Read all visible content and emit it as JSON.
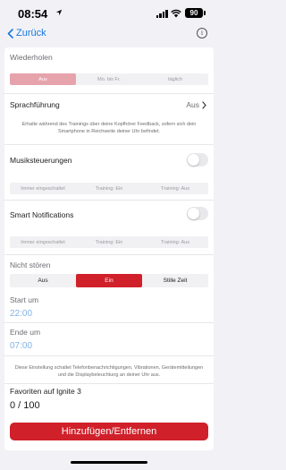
{
  "status_bar": {
    "time": "08:54",
    "battery": "90"
  },
  "nav": {
    "back_label": "Zurück"
  },
  "repeat": {
    "label": "Wiederholen",
    "options": [
      "Aus",
      "Mo. bis Fr.",
      "täglich"
    ],
    "selected": "Aus"
  },
  "voice_guidance": {
    "label": "Sprachführung",
    "value": "Aus",
    "description": "Erhalte während des Trainings über deine Kopfhörer Feedback, sofern sich dein Smartphone in Reichweite deiner Uhr befindet."
  },
  "music_control": {
    "label": "Musiksteuerungen",
    "enabled": false,
    "options": [
      "Immer eingeschaltet",
      "Training: Ein",
      "Training: Aus"
    ]
  },
  "smart_notifications": {
    "label": "Smart Notifications",
    "enabled": false,
    "options": [
      "Immer eingeschaltet",
      "Training: Ein",
      "Training: Aus"
    ]
  },
  "dnd": {
    "label": "Nicht stören",
    "options": [
      "Aus",
      "Ein",
      "Stille Zeit"
    ],
    "selected": "Ein",
    "start_label": "Start um",
    "start_value": "22:00",
    "end_label": "Ende um",
    "end_value": "07:00",
    "description": "Diese Einstellung schaltet Telefonbenachrichtigungen, Vibrationen, Gerätemitteilungen und die Displaybeleuchtung an deiner Uhr aus."
  },
  "favorites": {
    "label": "Favoriten auf Ignite 3",
    "count": "0 / 100"
  },
  "action": {
    "label": "Hinzufügen/Entfernen"
  },
  "colors": {
    "accent_red": "#d0202a",
    "selected_pink": "#e6a3ac",
    "link_blue": "#1677e0",
    "time_blue": "#7fb3e8"
  }
}
